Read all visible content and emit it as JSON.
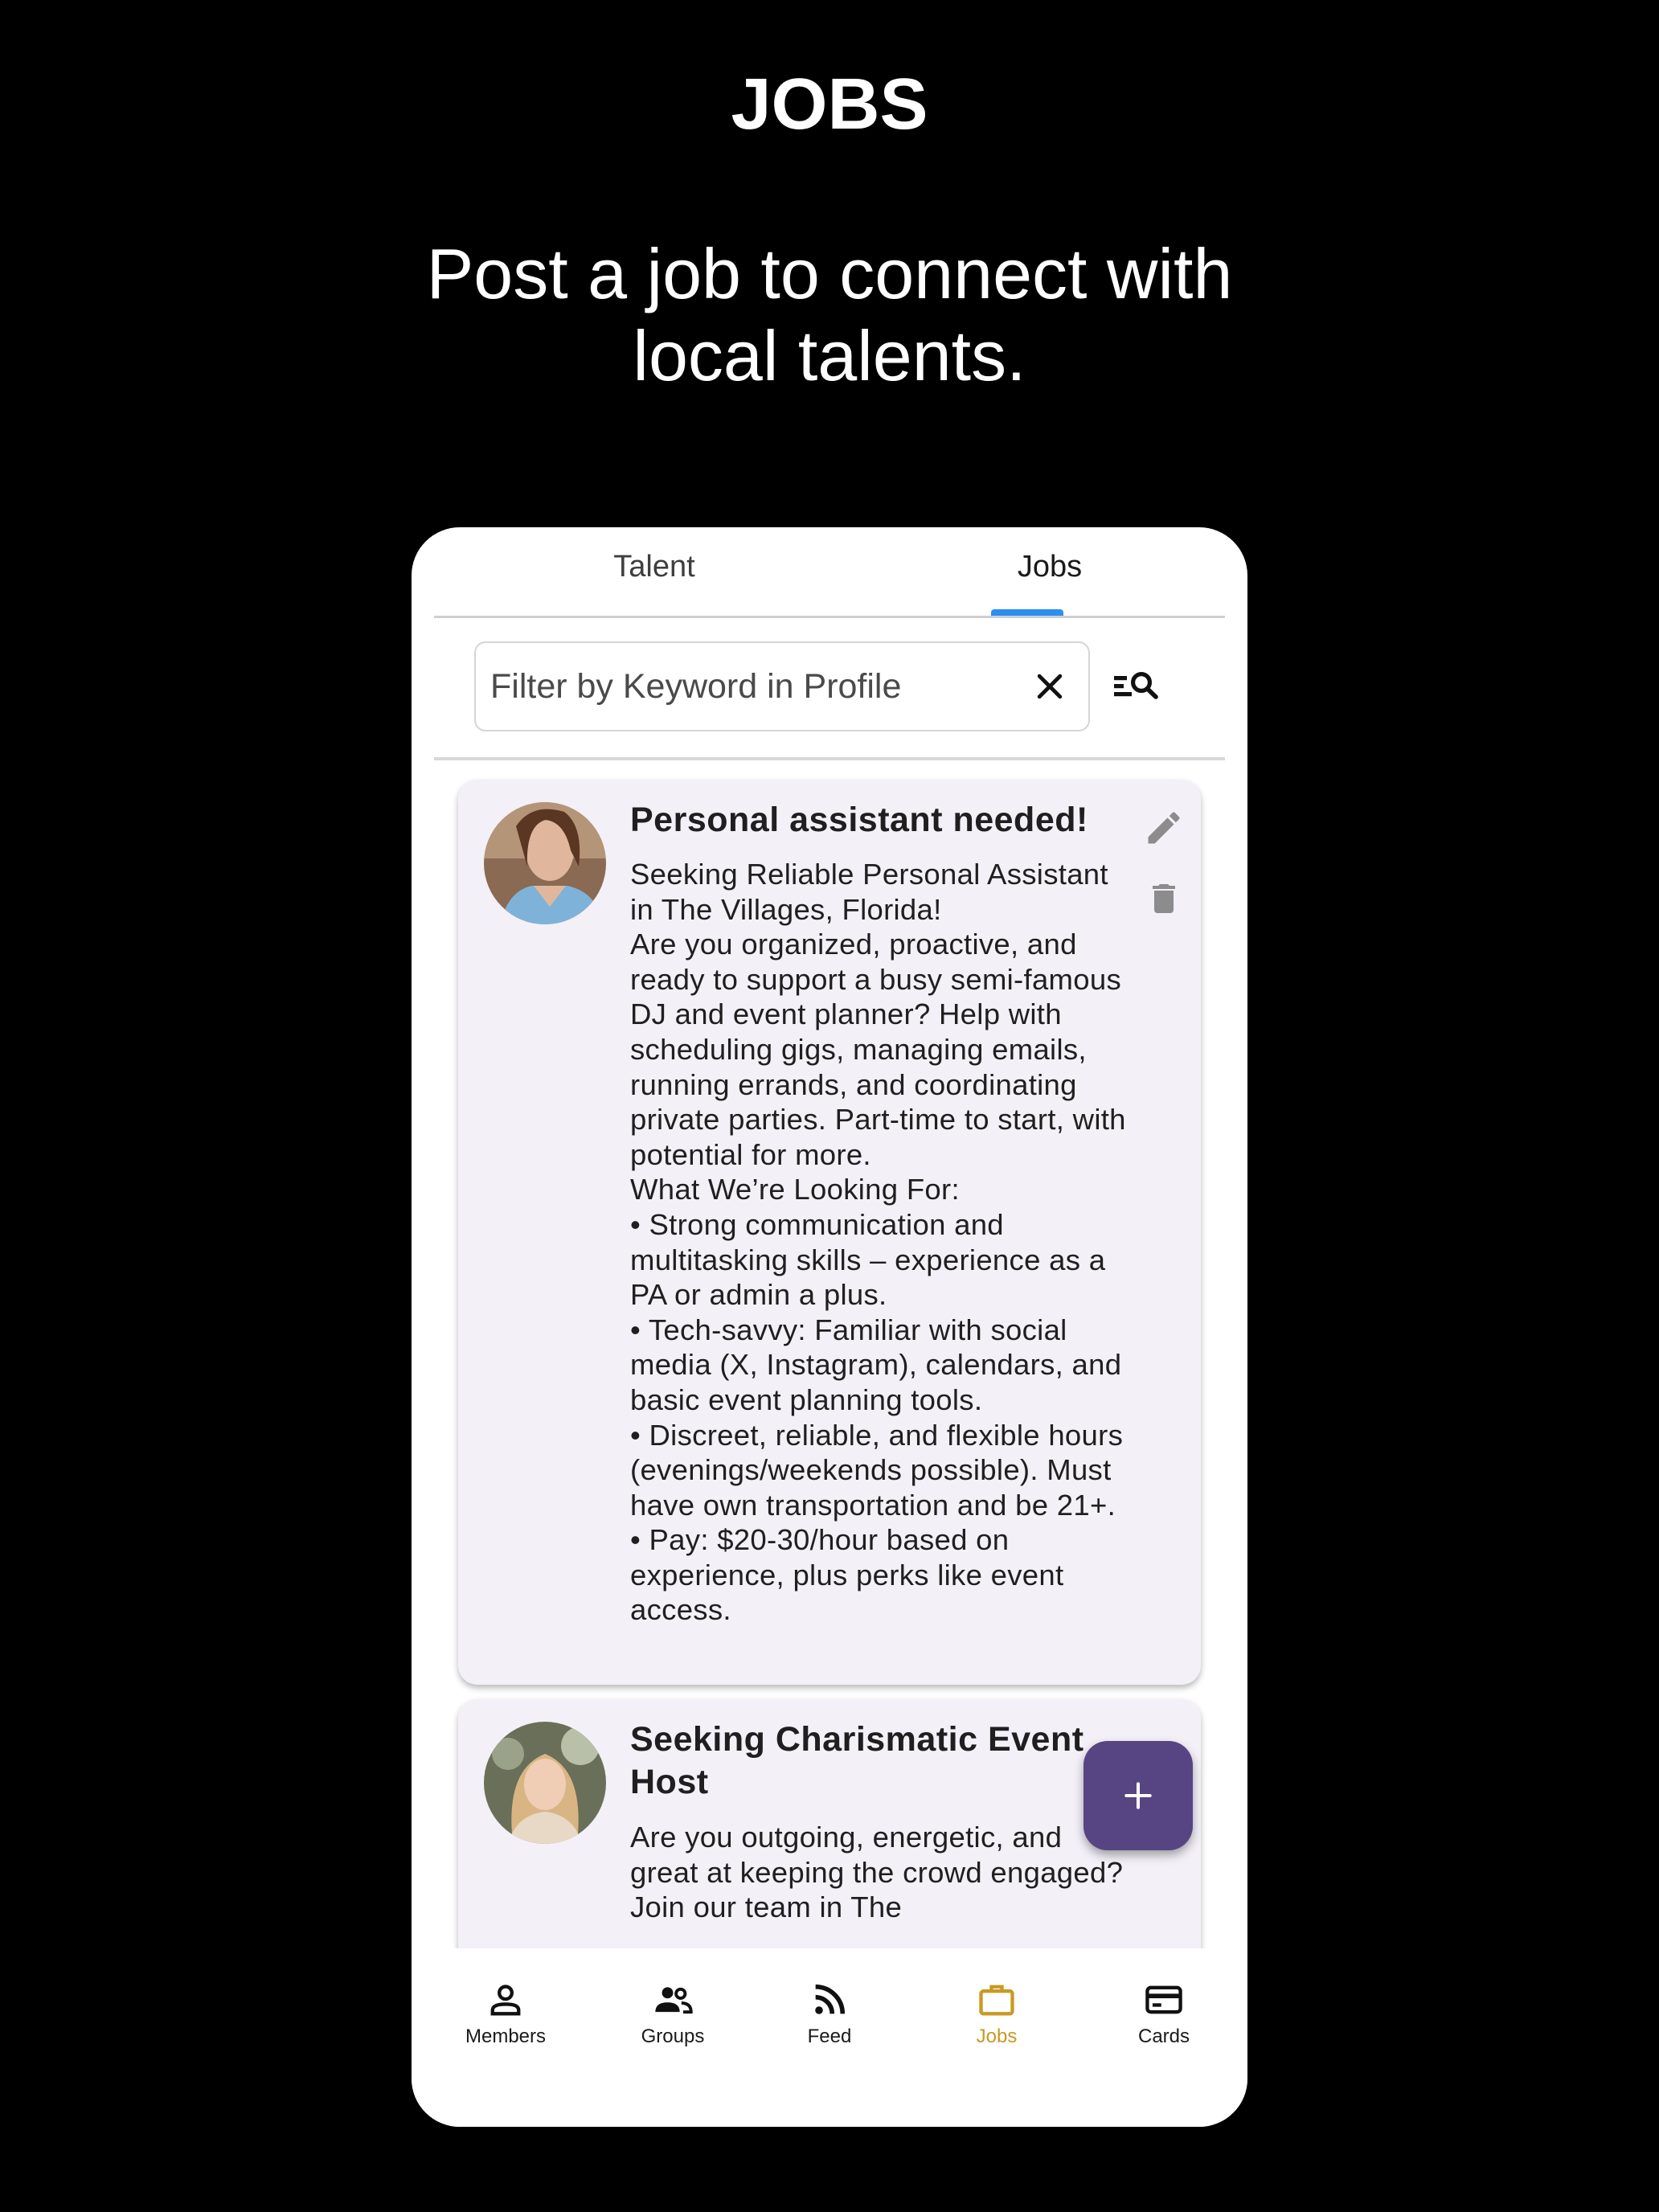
{
  "promo": {
    "title": "JOBS",
    "subtitle": "Post a job to connect with\nlocal  talents."
  },
  "tabs": [
    {
      "label": "Talent",
      "active": false
    },
    {
      "label": "Jobs",
      "active": true
    }
  ],
  "search": {
    "placeholder": "Filter by Keyword in Profile",
    "value": ""
  },
  "jobs": [
    {
      "title": "Personal assistant needed!",
      "body": "Seeking Reliable Personal Assistant in The Villages, Florida!\nAre you organized, proactive, and ready to support a busy semi-famous DJ and event planner? Help with scheduling gigs, managing emails, running errands, and coordinating private parties. Part-time to start, with potential for more.\nWhat We’re Looking For:\n•  Strong communication and multitasking skills – experience as a PA or admin a plus.\n•  Tech-savvy: Familiar with social media (X, Instagram), calendars, and basic event planning tools.\n•  Discreet, reliable, and flexible hours (evenings/weekends possible). Must have own transportation and be 21+.\n•  Pay: $20-30/hour based on experience, plus perks like event access."
    },
    {
      "title": "Seeking Charismatic Event Host",
      "body": "Are you outgoing, energetic, and great at keeping the crowd engaged? Join our team in The"
    }
  ],
  "nav": [
    {
      "label": "Members",
      "icon": "person-icon",
      "active": false
    },
    {
      "label": "Groups",
      "icon": "groups-icon",
      "active": false
    },
    {
      "label": "Feed",
      "icon": "rss-icon",
      "active": false
    },
    {
      "label": "Jobs",
      "icon": "briefcase-icon",
      "active": true
    },
    {
      "label": "Cards",
      "icon": "card-icon",
      "active": false
    }
  ],
  "colors": {
    "tab_indicator": "#2d8ff0",
    "card_background": "#f4f0f8",
    "fab": "#574483",
    "nav_active": "#c89a22"
  }
}
